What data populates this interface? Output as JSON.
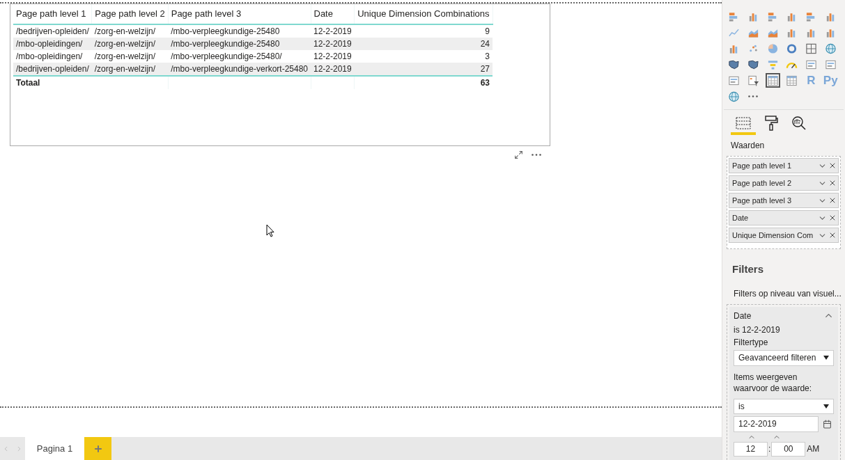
{
  "table": {
    "columns": [
      "Page path level 1",
      "Page path level 2",
      "Page path level 3",
      "Date",
      "Unique Dimension Combinations"
    ],
    "rows": [
      [
        "/bedrijven-opleiden/",
        "/zorg-en-welzijn/",
        "/mbo-verpleegkundige-25480",
        "12-2-2019",
        "9"
      ],
      [
        "/mbo-opleidingen/",
        "/zorg-en-welzijn/",
        "/mbo-verpleegkundige-25480",
        "12-2-2019",
        "24"
      ],
      [
        "/mbo-opleidingen/",
        "/zorg-en-welzijn/",
        "/mbo-verpleegkundige-25480/",
        "12-2-2019",
        "3"
      ],
      [
        "/bedrijven-opleiden/",
        "/zorg-en-welzijn/",
        "/mbo-verpleegkundige-verkort-25480",
        "12-2-2019",
        "27"
      ]
    ],
    "total": {
      "label": "Totaal",
      "value": "63"
    }
  },
  "page_tabs": [
    {
      "label": "Pagina 1",
      "selected": true
    }
  ],
  "visualizations": [
    {
      "kind": "bars-h",
      "selected": false
    },
    {
      "kind": "bars-v",
      "selected": false
    },
    {
      "kind": "bars-h",
      "selected": false
    },
    {
      "kind": "bars-v",
      "selected": false
    },
    {
      "kind": "bars-h",
      "selected": false
    },
    {
      "kind": "bars-v",
      "selected": false
    },
    {
      "kind": "line",
      "selected": false
    },
    {
      "kind": "area",
      "selected": false
    },
    {
      "kind": "area",
      "selected": false
    },
    {
      "kind": "bars-v",
      "selected": false
    },
    {
      "kind": "bars-v",
      "selected": false
    },
    {
      "kind": "bars-v",
      "selected": false
    },
    {
      "kind": "bars-v",
      "selected": false
    },
    {
      "kind": "scatter",
      "selected": false
    },
    {
      "kind": "pie",
      "selected": false
    },
    {
      "kind": "donut",
      "selected": false
    },
    {
      "kind": "grid",
      "selected": false
    },
    {
      "kind": "globe",
      "selected": false
    },
    {
      "kind": "map",
      "selected": false
    },
    {
      "kind": "map",
      "selected": false
    },
    {
      "kind": "funnel",
      "selected": false
    },
    {
      "kind": "gauge",
      "selected": false
    },
    {
      "kind": "card",
      "selected": false
    },
    {
      "kind": "card",
      "selected": false
    },
    {
      "kind": "card",
      "selected": false
    },
    {
      "kind": "filter",
      "selected": false
    },
    {
      "kind": "table",
      "selected": true
    },
    {
      "kind": "table",
      "selected": false
    },
    {
      "kind": "label",
      "label": "R",
      "selected": false
    },
    {
      "kind": "label",
      "label": "Py",
      "selected": false
    },
    {
      "kind": "globe",
      "selected": false
    },
    {
      "kind": "more",
      "selected": false
    }
  ],
  "pane_tabs": [
    {
      "kind": "fields",
      "selected": true
    },
    {
      "kind": "format",
      "selected": false
    },
    {
      "kind": "analytics",
      "selected": false
    }
  ],
  "wells": {
    "title": "Waarden",
    "fields": [
      "Page path level 1",
      "Page path level 2",
      "Page path level 3",
      "Date",
      "Unique Dimension Com"
    ]
  },
  "filters": {
    "title": "Filters",
    "section": "Filters op niveau van visuel...",
    "card": {
      "title": "Date",
      "expanded": true,
      "summary": "is 12-2-2019",
      "type_label": "Filtertype",
      "type_value": "Geavanceerd filteren",
      "description": "Items weergeven waarvoor de waarde:",
      "operator": "is",
      "date": "12-2-2019",
      "hour": "12",
      "separator": ":",
      "minute": "00",
      "ampm": "AM"
    }
  }
}
